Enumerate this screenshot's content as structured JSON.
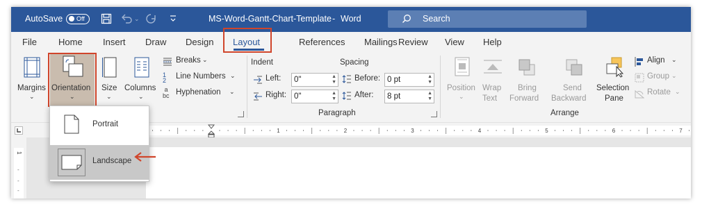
{
  "title_bar": {
    "autosave_label": "AutoSave",
    "autosave_state": "Off",
    "document_title": "MS-Word-Gantt-Chart-Template",
    "separator": "-",
    "app_name": "Word",
    "search_placeholder": "Search"
  },
  "tabs": [
    {
      "label": "File"
    },
    {
      "label": "Home"
    },
    {
      "label": "Insert"
    },
    {
      "label": "Draw"
    },
    {
      "label": "Design"
    },
    {
      "label": "Layout",
      "active": true
    },
    {
      "label": "References"
    },
    {
      "label": "Mailings"
    },
    {
      "label": "Review"
    },
    {
      "label": "View"
    },
    {
      "label": "Help"
    }
  ],
  "page_setup": {
    "margins_label": "Margins",
    "orientation_label": "Orientation",
    "size_label": "Size",
    "columns_label": "Columns",
    "breaks_label": "Breaks",
    "line_numbers_label": "Line Numbers",
    "hyphenation_label": "Hyphenation",
    "group_label_partial": "p"
  },
  "paragraph": {
    "indent_label": "Indent",
    "spacing_label": "Spacing",
    "left_label": "Left:",
    "left_value": "0\"",
    "right_label": "Right:",
    "right_value": "0\"",
    "before_label": "Before:",
    "before_value": "0 pt",
    "after_label": "After:",
    "after_value": "8 pt",
    "group_label": "Paragraph"
  },
  "arrange": {
    "position_label_1": "Position",
    "wrap_label_1": "Wrap",
    "wrap_label_2": "Text",
    "bring_label_1": "Bring",
    "bring_label_2": "Forward",
    "send_label_1": "Send",
    "send_label_2": "Backward",
    "selection_label_1": "Selection",
    "selection_label_2": "Pane",
    "align_label": "Align",
    "group_item_label": "Group",
    "rotate_label": "Rotate",
    "group_label": "Arrange"
  },
  "orientation_menu": {
    "portrait_label": "Portrait",
    "landscape_label": "Landscape",
    "selected": "Landscape"
  },
  "ruler_numbers": [
    "1",
    "1",
    "2",
    "3",
    "4",
    "5",
    "6",
    "7"
  ],
  "vertical_ruler_number": "1",
  "colors": {
    "word_blue": "#2b579a",
    "highlight_red": "#d0452b",
    "selected_button_bg": "#c9bcae"
  }
}
